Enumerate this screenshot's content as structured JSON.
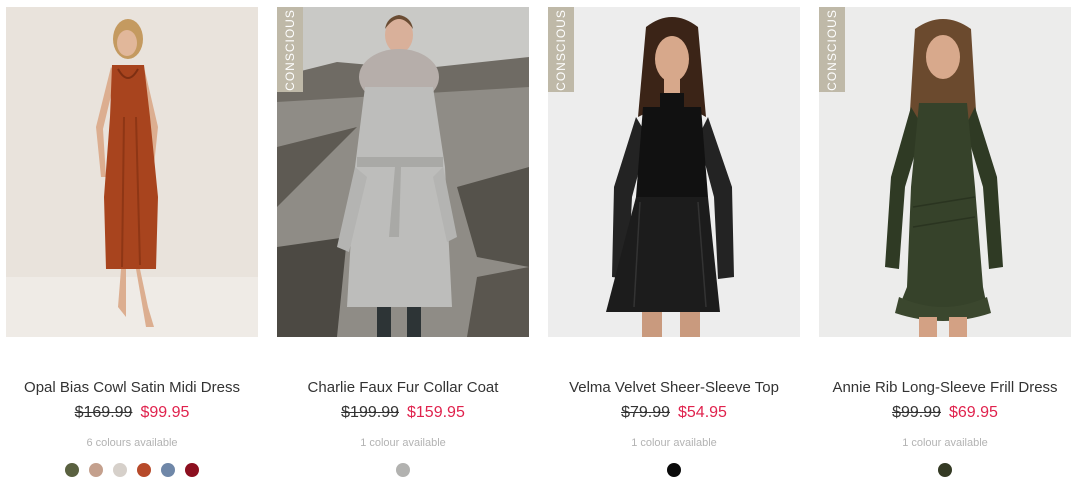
{
  "products": [
    {
      "name": "Opal Bias Cowl Satin Midi Dress",
      "was": "$169.99",
      "now": "$99.95",
      "colours_text": "6 colours available",
      "badge": "",
      "swatches": [
        "#5a6140",
        "#c4a08d",
        "#d6d0ca",
        "#b74a2a",
        "#6f87a8",
        "#8c0f1f"
      ]
    },
    {
      "name": "Charlie Faux Fur Collar Coat",
      "was": "$199.99",
      "now": "$159.95",
      "colours_text": "1 colour available",
      "badge": "CONSCIOUS",
      "swatches": [
        "#b2b2b0"
      ]
    },
    {
      "name": "Velma Velvet Sheer-Sleeve Top",
      "was": "$79.99",
      "now": "$54.95",
      "colours_text": "1 colour available",
      "badge": "CONSCIOUS",
      "swatches": [
        "#0a0a0a"
      ]
    },
    {
      "name": "Annie Rib Long-Sleeve Frill Dress",
      "was": "$99.99",
      "now": "$69.95",
      "colours_text": "1 colour available",
      "badge": "CONSCIOUS",
      "swatches": [
        "#343a24"
      ]
    }
  ],
  "colors": {
    "sale_price": "#e0224d",
    "badge_bg": "#bfb9a8"
  }
}
